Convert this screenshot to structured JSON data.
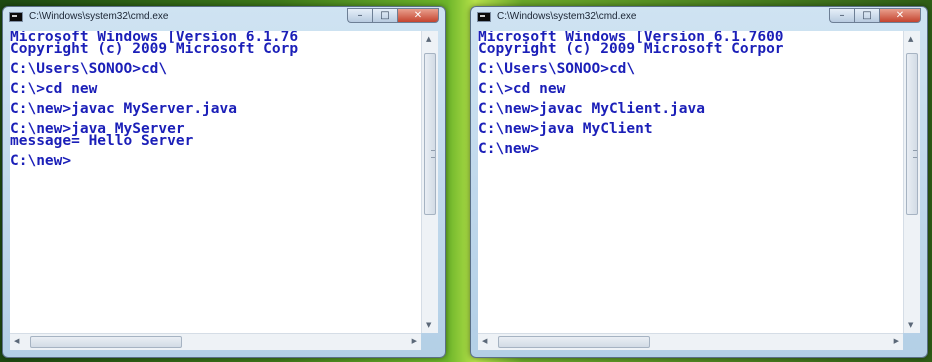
{
  "windows": [
    {
      "title": "C:\\Windows\\system32\\cmd.exe",
      "controls": {
        "minimize": "–",
        "maximize": "□",
        "close": "✕"
      },
      "lines": [
        "Microsoft Windows [Version 6.1.76",
        "Copyright (c) 2009 Microsoft Corp",
        "C:\\Users\\SONOO>cd\\",
        "C:\\>cd new",
        "C:\\new>javac MyServer.java",
        "C:\\new>java MyServer",
        "message= Hello Server",
        "C:\\new>"
      ]
    },
    {
      "title": "C:\\Windows\\system32\\cmd.exe",
      "controls": {
        "minimize": "–",
        "maximize": "□",
        "close": "✕"
      },
      "lines": [
        "Microsoft Windows [Version 6.1.7600",
        "Copyright (c) 2009 Microsoft Corpor",
        "C:\\Users\\SONOO>cd\\",
        "C:\\>cd new",
        "C:\\new>javac MyClient.java",
        "C:\\new>java MyClient",
        "C:\\new>"
      ]
    }
  ],
  "colors": {
    "console_text": "#1b1fb8",
    "console_bg": "#ffffff",
    "desktop_accent": "#b7e24a"
  },
  "icons": {
    "window": "cmd-window-icon",
    "scroll_up": "up-arrow-icon",
    "scroll_down": "down-arrow-icon",
    "scroll_left": "left-arrow-icon",
    "scroll_right": "right-arrow-icon"
  }
}
